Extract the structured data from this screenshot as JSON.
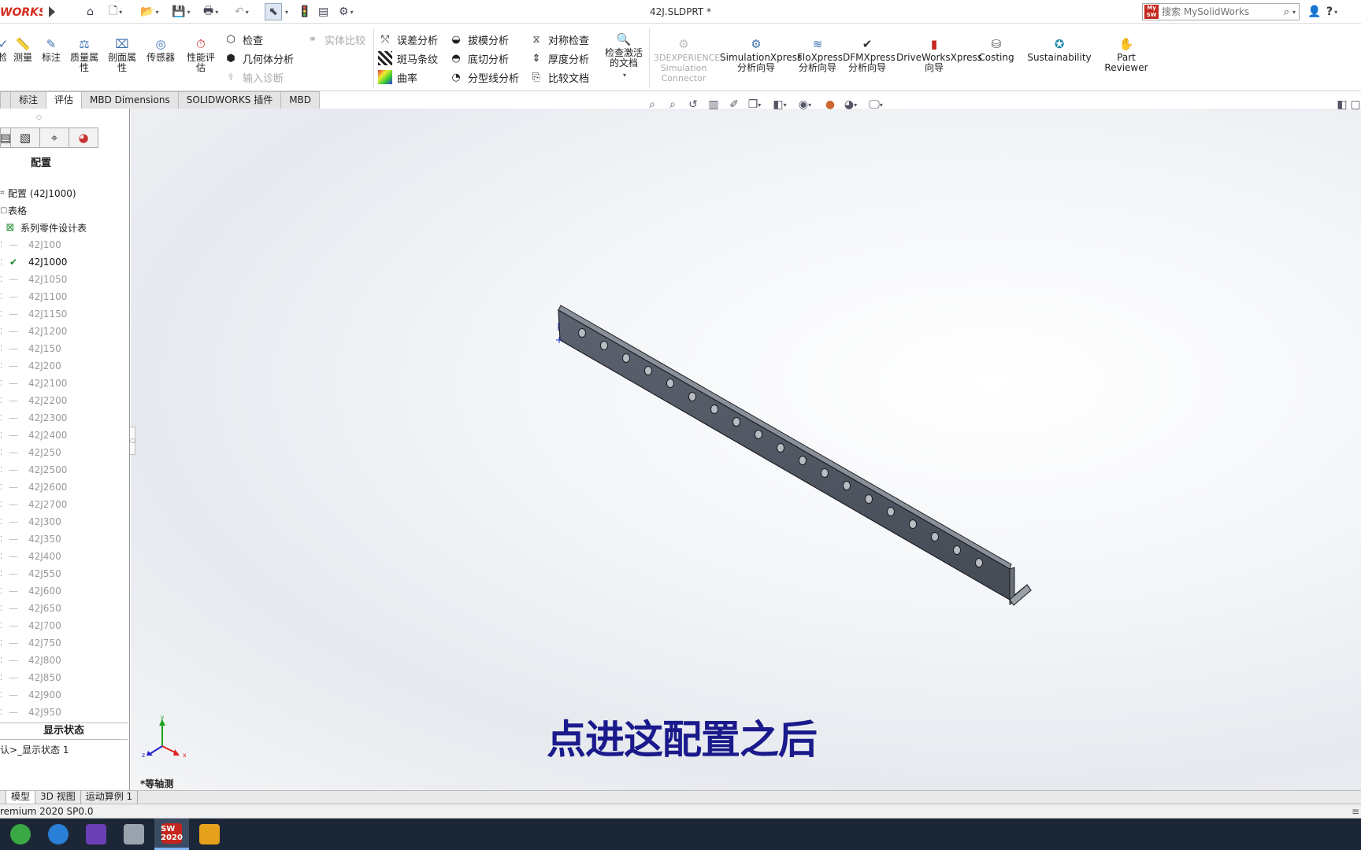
{
  "app": {
    "logo_text": "WORKS",
    "document_title": "42J.SLDPRT *",
    "search_placeholder": "搜索 MySolidWorks"
  },
  "ribbon": {
    "big_left": [
      {
        "label": "检"
      },
      {
        "label": "测量"
      },
      {
        "label": "标注"
      },
      {
        "label": "质量属性"
      },
      {
        "label": "剖面属性"
      },
      {
        "label": "传感器"
      },
      {
        "label": "性能评估"
      }
    ],
    "group1": [
      {
        "label": "检查",
        "disabled": false
      },
      {
        "label": "几何体分析",
        "disabled": false
      },
      {
        "label": "输入诊断",
        "disabled": true
      },
      {
        "label": "实体比较",
        "disabled": true
      }
    ],
    "group2": [
      {
        "label": "误差分析"
      },
      {
        "label": "斑马条纹"
      },
      {
        "label": "曲率"
      }
    ],
    "group3": [
      {
        "label": "拔模分析"
      },
      {
        "label": "底切分析"
      },
      {
        "label": "分型线分析"
      }
    ],
    "group4": [
      {
        "label": "对称检查"
      },
      {
        "label": "厚度分析"
      },
      {
        "label": "比较文档"
      }
    ],
    "check_activate": "检查激活的文档",
    "addins": [
      {
        "label": "3DEXPERIENCE Simulation Connector",
        "disabled": true
      },
      {
        "label": "SimulationXpress 分析向导"
      },
      {
        "label": "FloXpress 分析向导"
      },
      {
        "label": "DFMXpress 分析向导"
      },
      {
        "label": "DriveWorksXpress 向导"
      },
      {
        "label": "Costing"
      },
      {
        "label": "Sustainability"
      },
      {
        "label": "Part Reviewer"
      }
    ]
  },
  "tabs": [
    {
      "label": "",
      "active": false
    },
    {
      "label": "标注",
      "active": false
    },
    {
      "label": "评估",
      "active": true
    },
    {
      "label": "MBD Dimensions",
      "active": false
    },
    {
      "label": "SOLIDWORKS 插件",
      "active": false
    },
    {
      "label": "MBD",
      "active": false
    }
  ],
  "left_panel": {
    "heading": "配置",
    "root": "配置  (42J1000)",
    "tables": "表格",
    "design_table": "系列零件设计表",
    "configurations": [
      {
        "name": "42J100",
        "active": false
      },
      {
        "name": "42J1000",
        "active": true
      },
      {
        "name": "42J1050",
        "active": false
      },
      {
        "name": "42J1100",
        "active": false
      },
      {
        "name": "42J1150",
        "active": false
      },
      {
        "name": "42J1200",
        "active": false
      },
      {
        "name": "42J150",
        "active": false
      },
      {
        "name": "42J200",
        "active": false
      },
      {
        "name": "42J2100",
        "active": false
      },
      {
        "name": "42J2200",
        "active": false
      },
      {
        "name": "42J2300",
        "active": false
      },
      {
        "name": "42J2400",
        "active": false
      },
      {
        "name": "42J250",
        "active": false
      },
      {
        "name": "42J2500",
        "active": false
      },
      {
        "name": "42J2600",
        "active": false
      },
      {
        "name": "42J2700",
        "active": false
      },
      {
        "name": "42J300",
        "active": false
      },
      {
        "name": "42J350",
        "active": false
      },
      {
        "name": "42J400",
        "active": false
      },
      {
        "name": "42J550",
        "active": false
      },
      {
        "name": "42J600",
        "active": false
      },
      {
        "name": "42J650",
        "active": false
      },
      {
        "name": "42J700",
        "active": false
      },
      {
        "name": "42J750",
        "active": false
      },
      {
        "name": "42J800",
        "active": false
      },
      {
        "name": "42J850",
        "active": false
      },
      {
        "name": "42J900",
        "active": false
      },
      {
        "name": "42J950",
        "active": false
      }
    ],
    "display_state_header": "显示状态",
    "display_state_item": "认>_显示状态 1"
  },
  "viewport": {
    "overlay_text": "点进这配置之后",
    "view_label": "*等轴测",
    "triad_x": "x",
    "triad_y": "y",
    "triad_z": "z"
  },
  "bottom_tabs": [
    {
      "label": "",
      "active": false
    },
    {
      "label": "模型",
      "active": true
    },
    {
      "label": "3D 视图",
      "active": false
    },
    {
      "label": "运动算例 1",
      "active": false
    }
  ],
  "status_bar": {
    "text": "remium 2020 SP0.0"
  },
  "taskbar": [
    {
      "icon": "start-icon",
      "color": "#39a845",
      "label": ""
    },
    {
      "icon": "browser-icon",
      "color": "#2a7fd6",
      "label": ""
    },
    {
      "icon": "visual-studio-icon",
      "color": "#6a3fb5",
      "label": ""
    },
    {
      "icon": "media-icon",
      "color": "#9aa3ad",
      "label": ""
    },
    {
      "icon": "solidworks-icon",
      "color": "#c3261d",
      "label": "SW 2020",
      "active": true
    },
    {
      "icon": "app-icon",
      "color": "#e5a11c",
      "label": ""
    }
  ]
}
